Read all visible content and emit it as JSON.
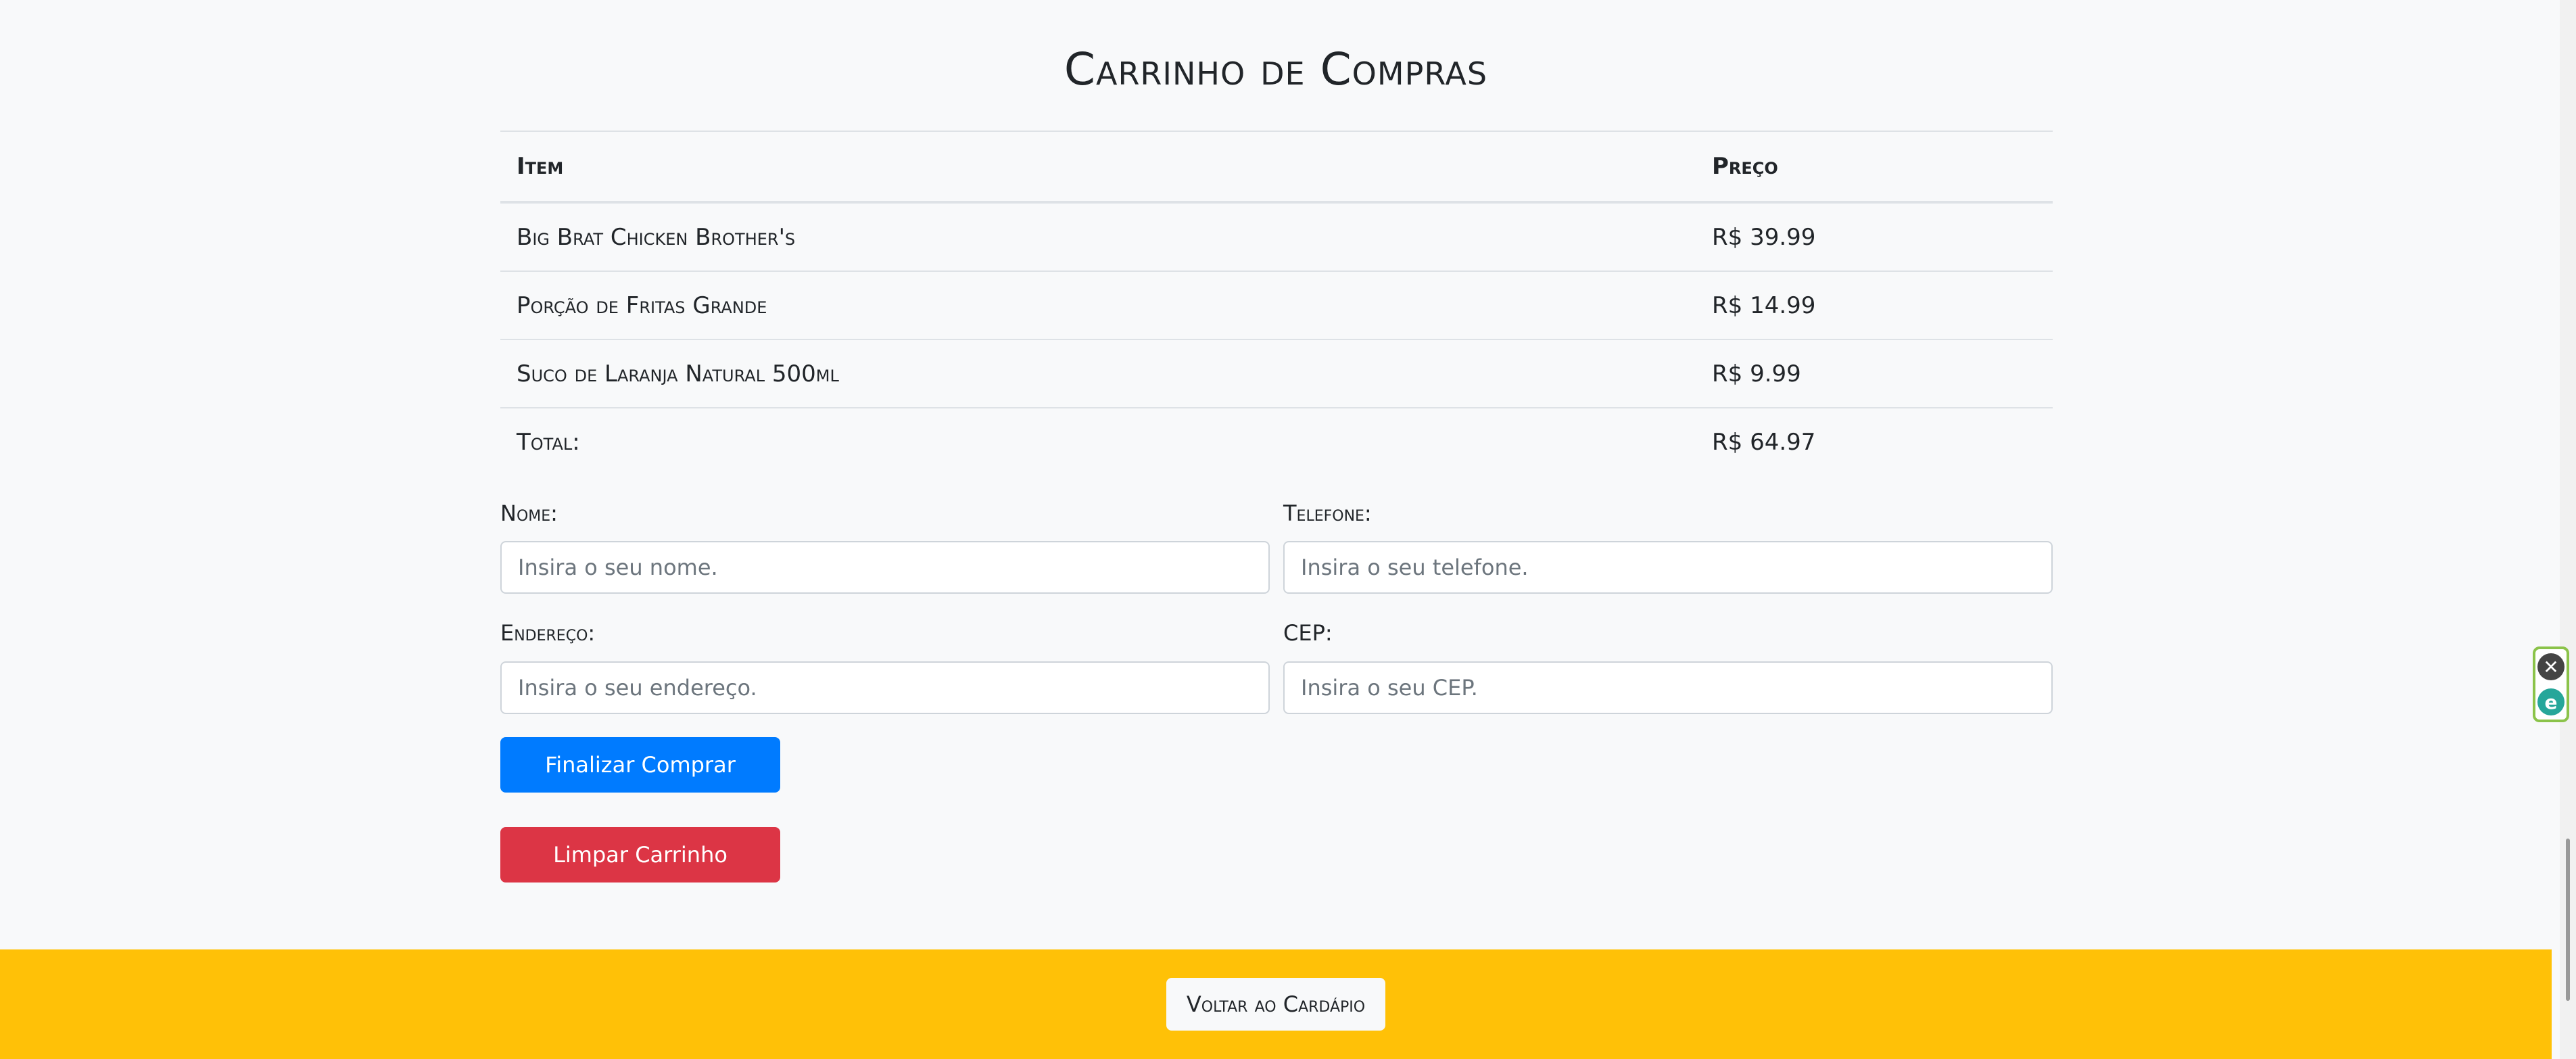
{
  "page": {
    "title": "Carrinho de Compras"
  },
  "cart": {
    "headers": {
      "item": "Item",
      "price": "Preço"
    },
    "rows": [
      {
        "item": "Big Brat Chicken Brother's",
        "price": "R$ 39.99"
      },
      {
        "item": "Porção de Fritas Grande",
        "price": "R$ 14.99"
      },
      {
        "item": "Suco de Laranja Natural 500ml",
        "price": "R$ 9.99"
      }
    ],
    "total_label": "Total:",
    "total_value": "R$ 64.97"
  },
  "form": {
    "nome_label": "Nome:",
    "nome_placeholder": "Insira o seu nome.",
    "telefone_label": "Telefone:",
    "telefone_placeholder": "Insira o seu telefone.",
    "endereco_label": "Endereço:",
    "endereco_placeholder": "Insira o seu endereço.",
    "cep_label": "CEP:",
    "cep_placeholder": "Insira o seu CEP."
  },
  "buttons": {
    "finalizar": "Finalizar Comprar",
    "limpar": "Limpar Carrinho",
    "voltar": "Voltar ao Cardápio"
  },
  "extension": {
    "close_glyph": "✕",
    "e_glyph": "e"
  },
  "colors": {
    "primary": "#007bff",
    "danger": "#dc3545",
    "footer": "#ffc107"
  }
}
